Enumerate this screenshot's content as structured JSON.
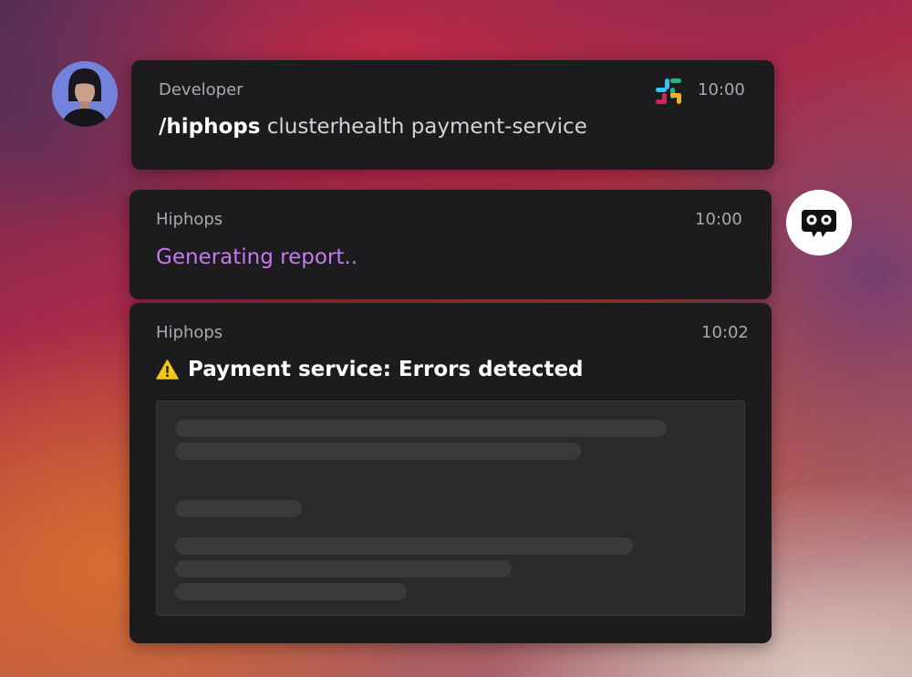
{
  "messages": [
    {
      "sender": "Developer",
      "time": "10:00",
      "command": "/hiphops",
      "args": "clusterhealth payment-service"
    },
    {
      "sender": "Hiphops",
      "time": "10:00",
      "status": "Generating report.."
    },
    {
      "sender": "Hiphops",
      "time": "10:02",
      "alert": "Payment service: Errors detected"
    }
  ],
  "icons": {
    "developer_avatar": "person-avatar",
    "platform": "slack-icon",
    "bot_avatar": "hiphops-bot-icon",
    "alert": "warning-icon"
  },
  "colors": {
    "card": "#1c1c1e",
    "status_text": "#c779f0",
    "warning": "#f5c518"
  }
}
